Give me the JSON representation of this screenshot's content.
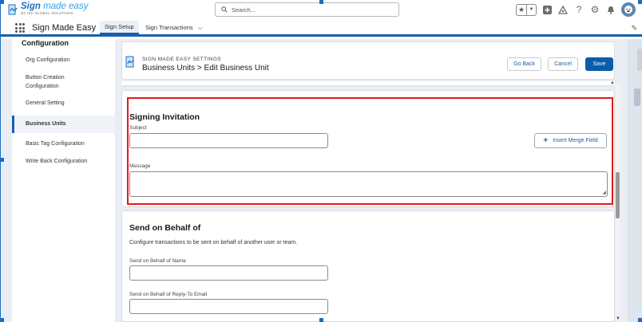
{
  "header": {
    "logo_title_bold": "Sign",
    "logo_title_light": " made easy",
    "logo_subtitle": "BY HIC GLOBAL SOLUTIONS",
    "search_placeholder": "Search...",
    "icons": [
      "star-icon",
      "chevron-down-icon",
      "add-icon",
      "trailhead-icon",
      "help-icon",
      "gear-icon",
      "bell-icon",
      "avatar-icon"
    ]
  },
  "nav": {
    "app_name": "Sign Made Easy",
    "tabs": [
      {
        "label": "Sign Setup",
        "active": true
      },
      {
        "label": "Sign Transactions",
        "active": false
      }
    ]
  },
  "sidebar": {
    "title": "Configuration",
    "items": [
      {
        "label": "Org Configuration"
      },
      {
        "label": "Button Creation Configuration"
      },
      {
        "label": "General Setting"
      },
      {
        "label": "Business Units",
        "active": true
      },
      {
        "label": "Basic Tag Configuration"
      },
      {
        "label": "Write Back Configuration"
      }
    ]
  },
  "page_header": {
    "eyebrow": "SIGN MADE EASY SETTINGS",
    "title": "Business Units > Edit Business Unit",
    "buttons": {
      "back": "Go Back",
      "cancel": "Cancel",
      "save": "Save"
    }
  },
  "signing_invitation": {
    "title": "Signing Invitation",
    "subject_label": "Subject",
    "subject_value": "",
    "merge_button": "Insert Merge Field",
    "message_label": "Message",
    "message_value": ""
  },
  "send_on_behalf": {
    "title": "Send on Behalf of",
    "description": "Configure transactions to be sent on behalf of another user or team.",
    "name_label": "Send on Behalf of Name",
    "name_value": "",
    "reply_label": "Send on Behalf of Reply-To Email",
    "reply_value": ""
  },
  "colors": {
    "brand_blue": "#0b5cab",
    "highlight_red": "#e0191e",
    "page_bg": "#e9eef5"
  }
}
